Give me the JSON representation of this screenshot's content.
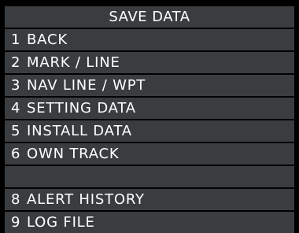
{
  "menu": {
    "title": "SAVE DATA",
    "items": [
      {
        "number": "1",
        "label": "BACK"
      },
      {
        "number": "2",
        "label": "MARK / LINE"
      },
      {
        "number": "3",
        "label": "NAV LINE / WPT"
      },
      {
        "number": "4",
        "label": "SETTING DATA"
      },
      {
        "number": "5",
        "label": "INSTALL DATA"
      },
      {
        "number": "6",
        "label": "OWN TRACK"
      },
      {
        "number": "",
        "label": ""
      },
      {
        "number": "8",
        "label": "ALERT HISTORY"
      },
      {
        "number": "9",
        "label": "LOG FILE"
      }
    ]
  }
}
